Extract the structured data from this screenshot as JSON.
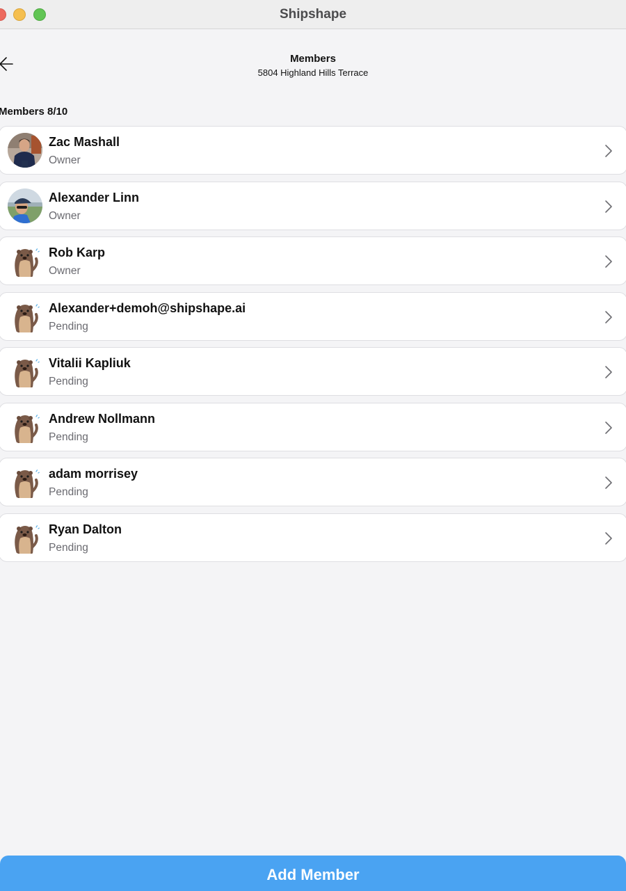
{
  "window": {
    "title": "Shipshape"
  },
  "header": {
    "title": "Members",
    "subtitle": "5804 Highland Hills Terrace"
  },
  "section": {
    "label": "Members 8/10"
  },
  "members": [
    {
      "name": "Zac Mashall",
      "role": "Owner",
      "avatar": "photo-man-navy-shirt"
    },
    {
      "name": "Alexander Linn",
      "role": "Owner",
      "avatar": "photo-man-cap-outdoor"
    },
    {
      "name": "Rob Karp",
      "role": "Owner",
      "avatar": "otter-mascot"
    },
    {
      "name": "Alexander+demoh@shipshape.ai",
      "role": "Pending",
      "avatar": "otter-mascot"
    },
    {
      "name": "Vitalii Kapliuk",
      "role": "Pending",
      "avatar": "otter-mascot"
    },
    {
      "name": "Andrew Nollmann",
      "role": "Pending",
      "avatar": "otter-mascot"
    },
    {
      "name": "adam morrisey",
      "role": "Pending",
      "avatar": "otter-mascot"
    },
    {
      "name": "Ryan Dalton",
      "role": "Pending",
      "avatar": "otter-mascot"
    }
  ],
  "actions": {
    "add_member_label": "Add Member"
  },
  "colors": {
    "accent": "#4aa3f2",
    "background": "#f4f4f6",
    "card": "#ffffff",
    "secondary_text": "#6a6a70"
  },
  "icons": {
    "back": "arrow-left-icon",
    "row_chevron": "chevron-right-icon"
  }
}
